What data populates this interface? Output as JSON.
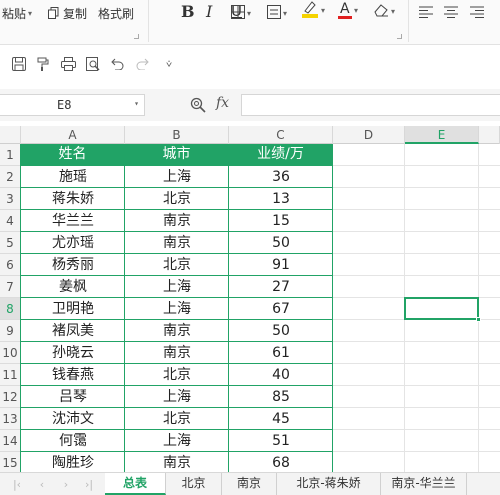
{
  "ribbon": {
    "paste_label": "粘贴",
    "copy_label": "复制",
    "format_painter_label": "格式刷"
  },
  "formula_bar": {
    "name_box": "E8",
    "fx_label": "fx",
    "formula_value": ""
  },
  "columns": [
    "A",
    "B",
    "C",
    "D",
    "E"
  ],
  "rows": [
    "1",
    "2",
    "3",
    "4",
    "5",
    "6",
    "7",
    "8",
    "9",
    "10",
    "11",
    "12",
    "13",
    "14",
    "15"
  ],
  "table": {
    "headers": [
      "姓名",
      "城市",
      "业绩/万"
    ],
    "rows": [
      [
        "施瑶",
        "上海",
        "36"
      ],
      [
        "蒋朱娇",
        "北京",
        "13"
      ],
      [
        "华兰兰",
        "南京",
        "15"
      ],
      [
        "尤亦瑶",
        "南京",
        "50"
      ],
      [
        "杨秀丽",
        "北京",
        "91"
      ],
      [
        "姜枫",
        "上海",
        "27"
      ],
      [
        "卫明艳",
        "上海",
        "67"
      ],
      [
        "褚凤美",
        "南京",
        "50"
      ],
      [
        "孙晓云",
        "南京",
        "61"
      ],
      [
        "钱春燕",
        "北京",
        "40"
      ],
      [
        "吕琴",
        "上海",
        "85"
      ],
      [
        "沈沛文",
        "北京",
        "45"
      ],
      [
        "何霭",
        "上海",
        "51"
      ],
      [
        "陶胜珍",
        "南京",
        "68"
      ]
    ]
  },
  "selected_cell": "E8",
  "sheet_tabs": [
    "总表",
    "北京",
    "南京",
    "北京-蒋朱娇",
    "南京-华兰兰"
  ],
  "active_tab": "总表",
  "colors": {
    "accent": "#21a366",
    "header_fill": "#21a366",
    "font_color_underline": "#e02020",
    "highlight_yellow": "#f5d300"
  }
}
